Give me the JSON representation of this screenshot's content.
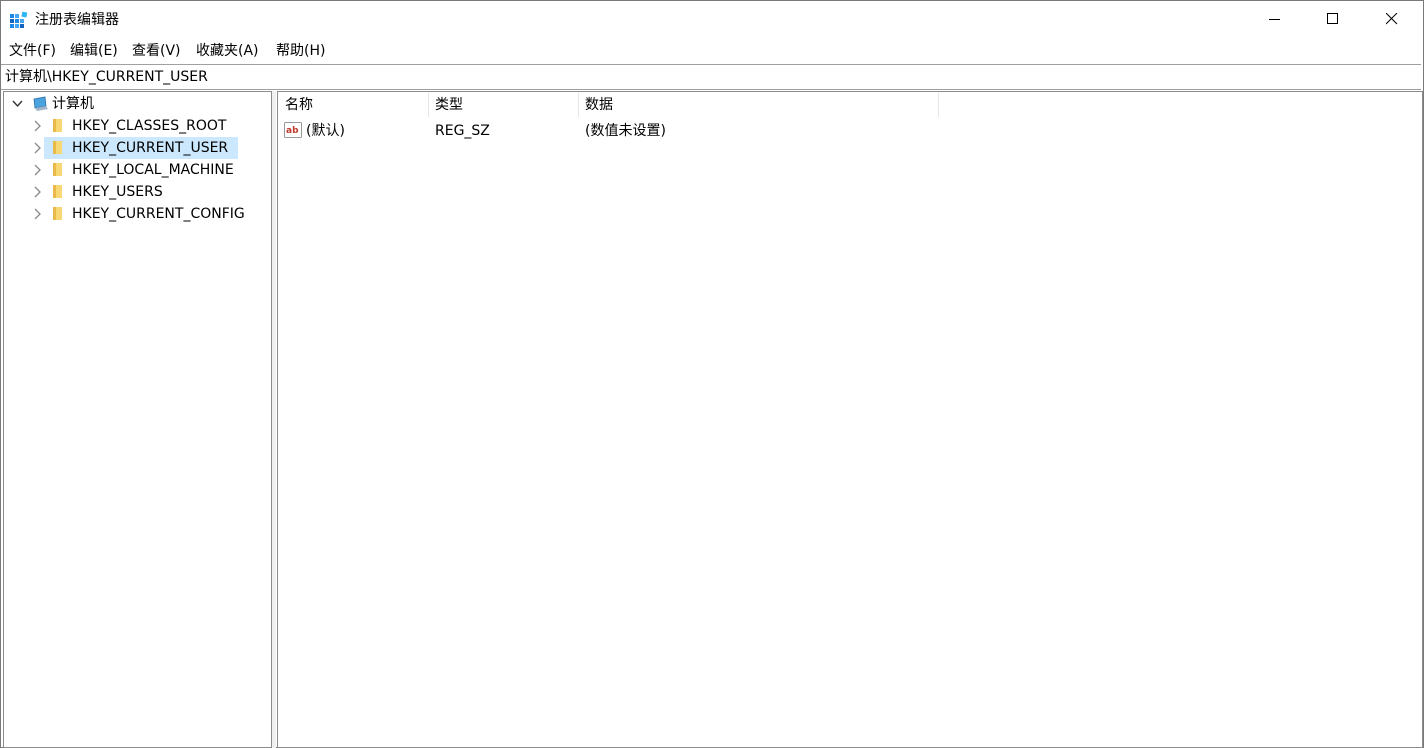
{
  "window": {
    "title": "注册表编辑器",
    "icon": "registry-editor-icon",
    "controls": [
      "minimize-icon",
      "maximize-icon",
      "close-icon"
    ]
  },
  "menu": {
    "items": [
      {
        "label": "文件(F)"
      },
      {
        "label": "编辑(E)"
      },
      {
        "label": "查看(V)"
      },
      {
        "label": "收藏夹(A)"
      },
      {
        "label": "帮助(H)"
      }
    ]
  },
  "address": {
    "path": "计算机\\HKEY_CURRENT_USER"
  },
  "tree": {
    "root": {
      "label": "计算机",
      "icon": "computer-icon",
      "expanded": true
    },
    "items": [
      {
        "label": "HKEY_CLASSES_ROOT",
        "icon": "folder-icon",
        "selected": false
      },
      {
        "label": "HKEY_CURRENT_USER",
        "icon": "folder-icon",
        "selected": true
      },
      {
        "label": "HKEY_LOCAL_MACHINE",
        "icon": "folder-icon",
        "selected": false
      },
      {
        "label": "HKEY_USERS",
        "icon": "folder-icon",
        "selected": false
      },
      {
        "label": "HKEY_CURRENT_CONFIG",
        "icon": "folder-icon",
        "selected": false
      }
    ]
  },
  "list": {
    "columns": [
      {
        "label": "名称"
      },
      {
        "label": "类型"
      },
      {
        "label": "数据"
      }
    ],
    "rows": [
      {
        "name": "(默认)",
        "type": "REG_SZ",
        "data": "(数值未设置)",
        "icon": "string-value-icon"
      }
    ]
  },
  "colors": {
    "selection": "#cce8ff",
    "folder": "#f8d775",
    "accent": "#0078d7"
  }
}
